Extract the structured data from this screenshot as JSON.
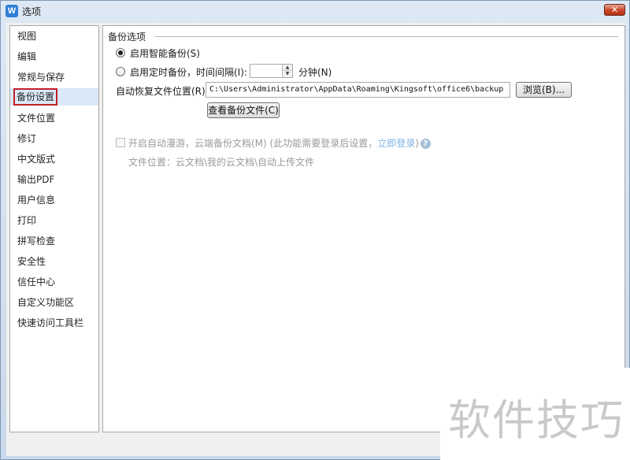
{
  "window": {
    "title": "选项",
    "app_icon_letter": "W",
    "close_glyph": "✕"
  },
  "sidebar": {
    "items": [
      {
        "label": "视图"
      },
      {
        "label": "编辑"
      },
      {
        "label": "常规与保存"
      },
      {
        "label": "备份设置",
        "selected": true
      },
      {
        "label": "文件位置"
      },
      {
        "label": "修订"
      },
      {
        "label": "中文版式"
      },
      {
        "label": "输出PDF"
      },
      {
        "label": "用户信息"
      },
      {
        "label": "打印"
      },
      {
        "label": "拼写检查"
      },
      {
        "label": "安全性"
      },
      {
        "label": "信任中心"
      },
      {
        "label": "自定义功能区"
      },
      {
        "label": "快速访问工具栏"
      }
    ]
  },
  "backup": {
    "group_title": "备份选项",
    "smart_backup_label": "启用智能备份(S)",
    "smart_backup_checked": true,
    "timed_backup_label": "启用定时备份，时间间隔(I):",
    "timed_backup_checked": false,
    "interval_value": "",
    "interval_unit": "分钟(N)",
    "recovery_location_label": "自动恢复文件位置(R):",
    "recovery_location_value": "C:\\Users\\Administrator\\AppData\\Roaming\\Kingsoft\\office6\\backup",
    "browse_button": "浏览(B)...",
    "view_backup_button": "查看备份文件(C)",
    "cloud_roaming_label": "开启自动漫游，云端备份文档(M) (此功能需要登录后设置，",
    "cloud_login_link": "立即登录",
    "cloud_roaming_suffix": ")",
    "cloud_roaming_checked": false,
    "cloud_location_text": "文件位置：云文档\\我的云文档\\自动上传文件",
    "help_glyph": "?"
  },
  "watermark": {
    "text": "软件技巧"
  }
}
